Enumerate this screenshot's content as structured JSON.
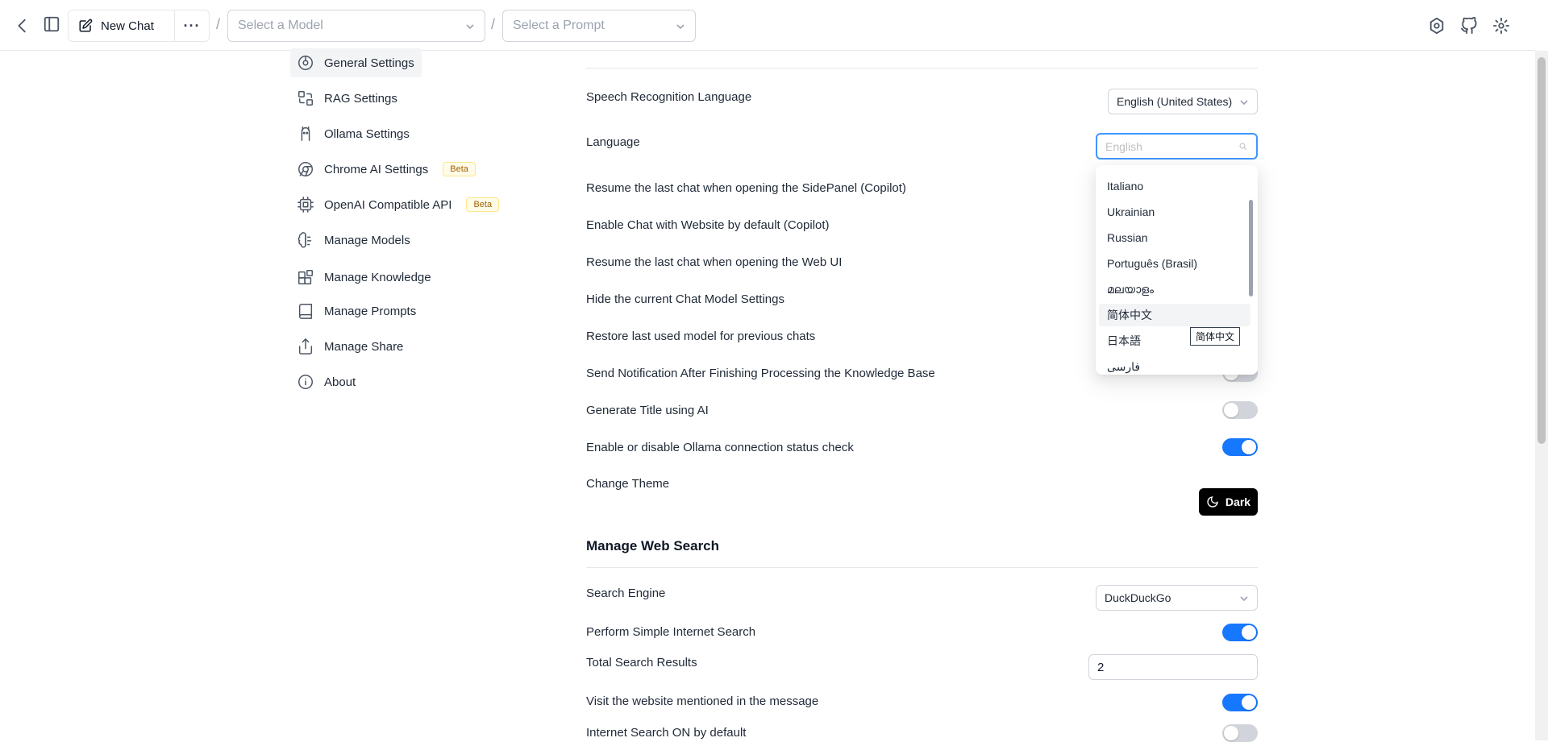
{
  "header": {
    "new_chat_label": "New Chat",
    "more_label": "···",
    "separator": "/",
    "model_placeholder": "Select a Model",
    "prompt_placeholder": "Select a Prompt"
  },
  "sidebar": {
    "items": [
      {
        "label": "General Settings",
        "icon": "general-settings-icon"
      },
      {
        "label": "RAG Settings",
        "icon": "rag-icon"
      },
      {
        "label": "Ollama Settings",
        "icon": "ollama-icon"
      },
      {
        "label": "Chrome AI Settings",
        "icon": "chrome-icon",
        "badge": "Beta"
      },
      {
        "label": "OpenAI Compatible API",
        "icon": "chip-icon",
        "badge": "Beta"
      },
      {
        "label": "Manage Models",
        "icon": "brain-icon"
      },
      {
        "label": "Manage Knowledge",
        "icon": "blocks-icon"
      },
      {
        "label": "Manage Prompts",
        "icon": "book-icon"
      },
      {
        "label": "Manage Share",
        "icon": "share-icon"
      },
      {
        "label": "About",
        "icon": "info-icon"
      }
    ]
  },
  "settings": {
    "speech_label": "Speech Recognition Language",
    "speech_value": "English (United States)",
    "language_label": "Language",
    "language_placeholder": "English",
    "rows": [
      {
        "label": "Resume the last chat when opening the SidePanel (Copilot)"
      },
      {
        "label": "Enable Chat with Website by default (Copilot)"
      },
      {
        "label": "Resume the last chat when opening the Web UI"
      },
      {
        "label": "Hide the current Chat Model Settings"
      },
      {
        "label": "Restore last used model for previous chats"
      },
      {
        "label": "Send Notification After Finishing Processing the Knowledge Base",
        "enabled": false
      },
      {
        "label": "Generate Title using AI",
        "enabled": false
      },
      {
        "label": "Enable or disable Ollama connection status check",
        "enabled": true
      }
    ],
    "theme_label": "Change Theme",
    "theme_button": "Dark"
  },
  "web_search": {
    "title": "Manage Web Search",
    "engine_label": "Search Engine",
    "engine_value": "DuckDuckGo",
    "simple_label": "Perform Simple Internet Search",
    "simple_enabled": true,
    "total_label": "Total Search Results",
    "total_value": "2",
    "visit_label": "Visit the website mentioned in the message",
    "visit_enabled": true,
    "default_on_label": "Internet Search ON by default",
    "default_on_enabled": false
  },
  "language_dropdown": {
    "options": [
      "Italiano",
      "Ukrainian",
      "Russian",
      "Português (Brasil)",
      "മലയാളം",
      "简体中文",
      "日本語",
      "فارسی"
    ],
    "hovered_index": 5,
    "tooltip": "简体中文"
  },
  "colors": {
    "accent": "#1677ff",
    "toggle_off": "#d1d5db",
    "beta_bg": "#fefce8"
  }
}
